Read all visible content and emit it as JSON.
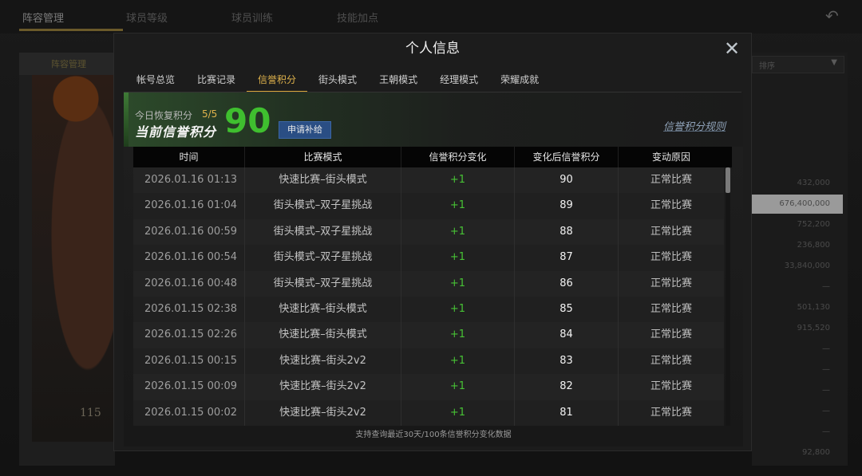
{
  "background": {
    "tabs": [
      {
        "label": "阵容管理"
      },
      {
        "label": "球员等级"
      },
      {
        "label": "球员训练"
      },
      {
        "label": "技能加点"
      }
    ],
    "left_header": "阵容管理",
    "player_text": "115",
    "right_select_value": "排序",
    "right_values": [
      "432,000",
      "676,400,000",
      "752,200",
      "236,800",
      "33,840,000",
      "—",
      "501,130",
      "915,520",
      "—",
      "—",
      "—",
      "—",
      "—",
      "92,800"
    ]
  },
  "modal": {
    "title": "个人信息",
    "tabs": [
      {
        "label": "帐号总览",
        "active": false
      },
      {
        "label": "比赛记录",
        "active": false
      },
      {
        "label": "信誉积分",
        "active": true
      },
      {
        "label": "街头模式",
        "active": false
      },
      {
        "label": "王朝模式",
        "active": false
      },
      {
        "label": "经理模式",
        "active": false
      },
      {
        "label": "荣耀成就",
        "active": false
      }
    ],
    "banner": {
      "today_label": "今日恢复积分",
      "today_value": "5/5",
      "current_label": "当前信誉积分",
      "score": "90",
      "apply_button": "申请补给",
      "rules_link": "信誉积分规则"
    },
    "table": {
      "headers": [
        "时间",
        "比赛模式",
        "信誉积分变化",
        "变化后信誉积分",
        "变动原因"
      ],
      "rows": [
        {
          "time": "2026.01.16  01:13",
          "mode": "快速比赛–街头模式",
          "change": "+1",
          "after": "90",
          "reason": "正常比赛"
        },
        {
          "time": "2026.01.16  01:04",
          "mode": "街头模式–双子星挑战",
          "change": "+1",
          "after": "89",
          "reason": "正常比赛"
        },
        {
          "time": "2026.01.16  00:59",
          "mode": "街头模式–双子星挑战",
          "change": "+1",
          "after": "88",
          "reason": "正常比赛"
        },
        {
          "time": "2026.01.16  00:54",
          "mode": "街头模式–双子星挑战",
          "change": "+1",
          "after": "87",
          "reason": "正常比赛"
        },
        {
          "time": "2026.01.16  00:48",
          "mode": "街头模式–双子星挑战",
          "change": "+1",
          "after": "86",
          "reason": "正常比赛"
        },
        {
          "time": "2026.01.15  02:38",
          "mode": "快速比赛–街头模式",
          "change": "+1",
          "after": "85",
          "reason": "正常比赛"
        },
        {
          "time": "2026.01.15  02:26",
          "mode": "快速比赛–街头模式",
          "change": "+1",
          "after": "84",
          "reason": "正常比赛"
        },
        {
          "time": "2026.01.15  00:15",
          "mode": "快速比赛–街头2v2",
          "change": "+1",
          "after": "83",
          "reason": "正常比赛"
        },
        {
          "time": "2026.01.15  00:09",
          "mode": "快速比赛–街头2v2",
          "change": "+1",
          "after": "82",
          "reason": "正常比赛"
        },
        {
          "time": "2026.01.15  00:02",
          "mode": "快速比赛–街头2v2",
          "change": "+1",
          "after": "81",
          "reason": "正常比赛"
        }
      ]
    },
    "footer_note": "支持查询最近30天/100条信誉积分变化数据"
  }
}
